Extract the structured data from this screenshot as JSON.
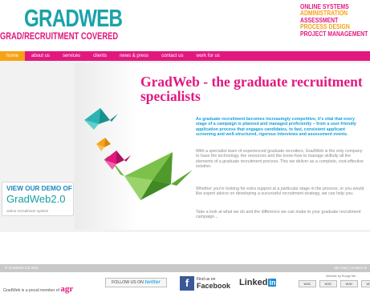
{
  "header": {
    "logo_main": "GRADWEB",
    "logo_sub": "GRAD/RECRUITMENT COVERED",
    "services": [
      {
        "label": "ONLINE SYSTEMS",
        "color": "#e2187f"
      },
      {
        "label": "ADMINISTRATION",
        "color": "#f5a315"
      },
      {
        "label": "ASSESSMENT",
        "color": "#e2187f"
      },
      {
        "label": "PROCESS DESIGN",
        "color": "#f5a315"
      },
      {
        "label": "PROJECT MANAGEMENT",
        "color": "#e2187f"
      }
    ]
  },
  "nav": {
    "items": [
      "home",
      "about us",
      "services",
      "clients",
      "news & press",
      "contact us",
      "work for us"
    ]
  },
  "main": {
    "title": "GradWeb - the graduate recruitment specialists",
    "intro": "As graduate recruitment becomes increasingly competitive, it's vital that every stage of a campaign is planned and managed proficiently – from a user-friendly application process that engages candidates, to fast, consistent applicant screening and well-structured, rigorous interviews and assessment events.",
    "para1": "With a specialist team of experienced graduate recruiters, GradWeb is the only company to have the technology, the resources and the know-how to manage skilfully all the elements of a graduate recruitment process. This we deliver as a complete, cost-effective solution.",
    "para2": "Whether you're looking for extra support at a particular stage in the process, or you would like expert advice on developing a successful recruitment strategy, we can help you.",
    "para3": "Take a look at what we do and the difference we can make to your graduate recruitment campaign..."
  },
  "demo": {
    "line1": "VIEW OUR DEMO OF",
    "line2": "GradWeb2.0",
    "line3": "online recruitment system"
  },
  "footer": {
    "copyright": "© GradWeb Ltd 2011",
    "links": "site map | contact us",
    "member_text": "GradWeb is a proud member of",
    "member_logo": "agr",
    "twitter_prefix": "FOLLOW US ON",
    "twitter_brand": "twitter",
    "facebook_small": "Find us on",
    "facebook_big": "Facebook",
    "linkedin": "Linked",
    "linkedin_in": "in",
    "credit": "Website by Rouge Me",
    "badges": [
      "W3C",
      "W3C",
      "W3C",
      "W3C"
    ]
  },
  "colors": {
    "pink": "#e2187f",
    "orange": "#f5a315",
    "teal": "#1aa3a8",
    "blue": "#14a0d8"
  }
}
